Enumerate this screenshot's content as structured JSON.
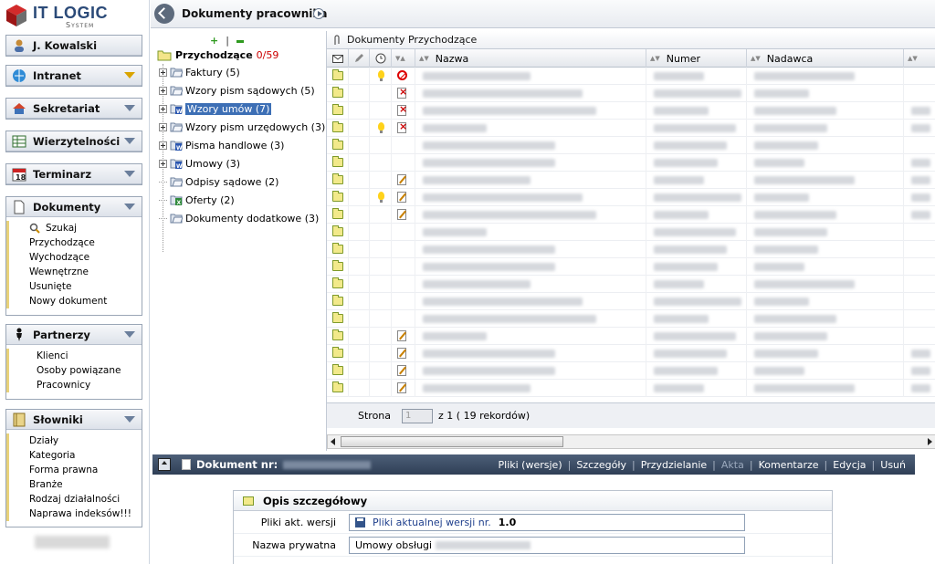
{
  "logo": {
    "line1": "IT LOGIC",
    "line2": "System"
  },
  "user": {
    "name": "J. Kowalski"
  },
  "sidebar": {
    "intranet": "Intranet",
    "sekretariat": "Sekretariat",
    "wierzytelnosci": "Wierzytelności",
    "terminarz": "Terminarz",
    "dokumenty": {
      "label": "Dokumenty",
      "items": [
        "Szukaj",
        "Przychodzące",
        "Wychodzące",
        "Wewnętrzne",
        "Usunięte",
        "Nowy dokument"
      ]
    },
    "partnerzy": {
      "label": "Partnerzy",
      "items": [
        "Klienci",
        "Osoby powiązane",
        "Pracownicy"
      ]
    },
    "slowniki": {
      "label": "Słowniki",
      "items": [
        "Działy",
        "Kategoria",
        "Forma prawna",
        "Branże",
        "Rodzaj działalności",
        "Naprawa indeksów!!!"
      ]
    }
  },
  "header": {
    "title": "Dokumenty pracownika"
  },
  "tree": {
    "root_label": "Przychodzące",
    "root_count": "0/59",
    "nodes": [
      {
        "label": "Faktury (5)",
        "icon": "folder-icon",
        "expandable": true
      },
      {
        "label": "Wzory pism sądowych (5)",
        "icon": "folder-icon",
        "expandable": true
      },
      {
        "label": "Wzory umów (7)",
        "icon": "word-doc-icon",
        "expandable": true,
        "selected": true
      },
      {
        "label": "Wzory pism urzędowych (3)",
        "icon": "folder-icon",
        "expandable": true
      },
      {
        "label": "Pisma handlowe (3)",
        "icon": "word-doc-icon",
        "expandable": true
      },
      {
        "label": "Umowy (3)",
        "icon": "word-doc-icon",
        "expandable": true
      },
      {
        "label": "Odpisy sądowe (2)",
        "icon": "folder-icon",
        "expandable": false
      },
      {
        "label": "Oferty (2)",
        "icon": "excel-doc-icon",
        "expandable": false
      },
      {
        "label": "Dokumenty dodatkowe (3)",
        "icon": "folder-icon",
        "expandable": false
      }
    ]
  },
  "grid": {
    "title": "Dokumenty Przychodzące",
    "columns": {
      "nazwa": "Nazwa",
      "numer": "Numer",
      "nadawca": "Nadawca"
    },
    "rows": [
      {
        "bulb": true,
        "status": "no"
      },
      {
        "bulb": false,
        "status": "x"
      },
      {
        "bulb": false,
        "status": "x"
      },
      {
        "bulb": true,
        "status": "x"
      },
      {
        "bulb": false,
        "status": ""
      },
      {
        "bulb": false,
        "status": ""
      },
      {
        "bulb": false,
        "status": "pen"
      },
      {
        "bulb": true,
        "status": "pen"
      },
      {
        "bulb": false,
        "status": "pen"
      },
      {
        "bulb": false,
        "status": ""
      },
      {
        "bulb": false,
        "status": ""
      },
      {
        "bulb": false,
        "status": ""
      },
      {
        "bulb": false,
        "status": ""
      },
      {
        "bulb": false,
        "status": ""
      },
      {
        "bulb": false,
        "status": ""
      },
      {
        "bulb": false,
        "status": "pen"
      },
      {
        "bulb": false,
        "status": "pen"
      },
      {
        "bulb": false,
        "status": "pen"
      },
      {
        "bulb": false,
        "status": "pen"
      }
    ],
    "pager": {
      "label": "Strona",
      "page": "1",
      "of": "z 1 ( 19 rekordów)"
    }
  },
  "detail": {
    "title": "Dokument nr:",
    "links": [
      "Pliki (wersje)",
      "Szczegóły",
      "Przydzielanie",
      "Akta",
      "Komentarze",
      "Edycja",
      "Usuń"
    ],
    "section_title": "Opis szczegółowy",
    "field1_label": "Pliki akt. wersji",
    "field1_link": "Pliki aktualnej wersji nr.",
    "field1_version": "1.0",
    "field2_label": "Nazwa prywatna",
    "field2_value": "Umowy obsługi"
  },
  "colors": {
    "accent": "#3d6fb5",
    "header_dark": "#2f3f56",
    "sidebar_border": "#9aa6b6"
  }
}
